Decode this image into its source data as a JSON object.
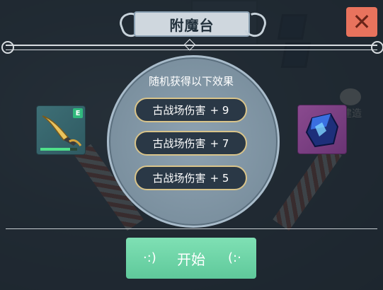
{
  "title": "附魔台",
  "close_symbol": "✕",
  "effects_heading": "随机获得以下效果",
  "effects": [
    {
      "name": "古战场伤害",
      "value": "+ 9"
    },
    {
      "name": "古战场伤害",
      "value": "+ 7"
    },
    {
      "name": "古战场伤害",
      "value": "+ 5"
    }
  ],
  "weapon_slot": {
    "tier": "E",
    "durability": 0.8,
    "icon": "dagger-icon"
  },
  "catalyst_slot": {
    "icon": "blue-gem-cube-icon"
  },
  "start_button": {
    "label": "开始"
  },
  "background_hint": {
    "label": "建造"
  },
  "colors": {
    "close": "#e8735d",
    "start": "#6fd7a8",
    "pill_border": "#d9c48a",
    "tier_badge": "#31b97d"
  }
}
